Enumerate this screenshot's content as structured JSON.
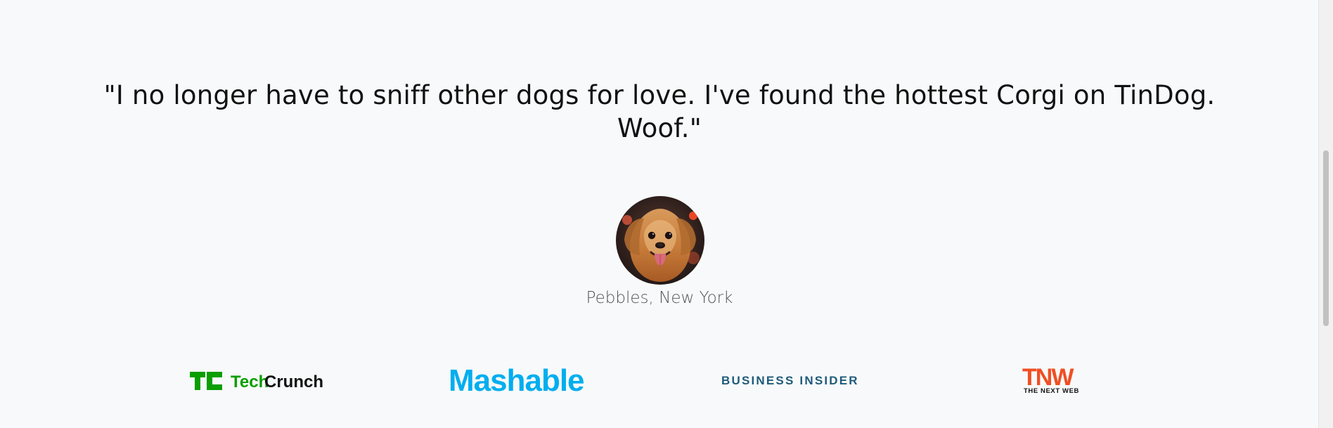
{
  "testimonial": {
    "quote": "\"I no longer have to sniff other dogs for love. I've found the hottest Corgi on TinDog. Woof.\"",
    "author": "Pebbles, New York",
    "avatar_alt": "dog-profile"
  },
  "press": {
    "logos": [
      {
        "name": "techcrunch",
        "brand": "TechCrunch",
        "tc": "TC",
        "word1": "Tech",
        "word2": "Crunch",
        "color": "#0a9e01"
      },
      {
        "name": "mashable",
        "brand": "Mashable",
        "color": "#00aeef"
      },
      {
        "name": "business-insider",
        "brand": "BUSINESS INSIDER",
        "color": "#1f5b7a"
      },
      {
        "name": "tnw",
        "brand": "TNW",
        "subtitle": "THE NEXT WEB",
        "color": "#f04e23"
      }
    ]
  },
  "scrollbar": {
    "present": true
  },
  "colors": {
    "background": "#f8f9fa",
    "text": "#111111",
    "caption": "#555555"
  }
}
